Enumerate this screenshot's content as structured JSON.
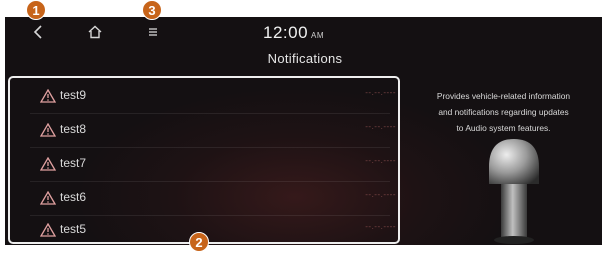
{
  "status_bar": {
    "time": "12:00",
    "ampm": "AM"
  },
  "page": {
    "title": "Notifications"
  },
  "notifications": [
    {
      "title": "test9",
      "date": "--.--.----"
    },
    {
      "title": "test8",
      "date": "--.--.----"
    },
    {
      "title": "test7",
      "date": "--.--.----"
    },
    {
      "title": "test6",
      "date": "--.--.----"
    },
    {
      "title": "test5",
      "date": "--.--.----"
    }
  ],
  "side_info": {
    "line1": "Provides vehicle-related information",
    "line2": "and notifications regarding updates",
    "line3": "to Audio system features."
  },
  "callouts": {
    "one": "1",
    "two": "2",
    "three": "3"
  },
  "icons": {
    "back": "back-icon",
    "home": "home-icon",
    "menu": "menu-icon",
    "warning": "warning-icon",
    "bell": "bell-icon"
  },
  "colors": {
    "callout": "#c7641a",
    "background": "#1e1214",
    "list_border": "#eeeeee"
  }
}
